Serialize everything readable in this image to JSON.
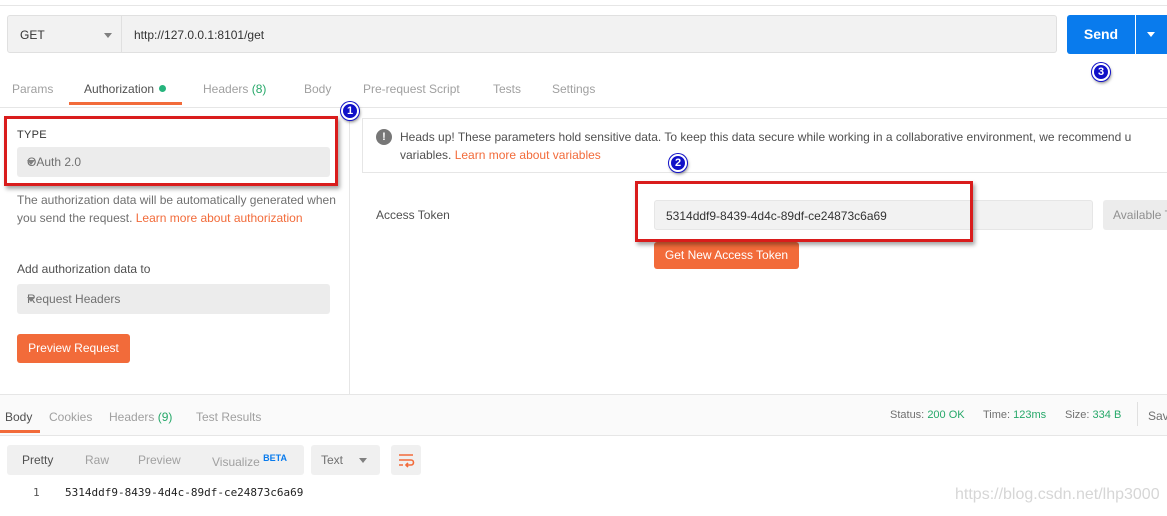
{
  "request": {
    "method": "GET",
    "url": "http://127.0.0.1:8101/get",
    "send_label": "Send"
  },
  "request_tabs": [
    {
      "label": "Params"
    },
    {
      "label": "Authorization"
    },
    {
      "label": "Headers",
      "count": "(8)"
    },
    {
      "label": "Body"
    },
    {
      "label": "Pre-request Script"
    },
    {
      "label": "Tests"
    },
    {
      "label": "Settings"
    }
  ],
  "auth": {
    "type_label": "TYPE",
    "type_value": "OAuth 2.0",
    "description": "The authorization data will be automatically generated when you send the request. ",
    "learn_more": "Learn more about authorization",
    "add_to_label": "Add authorization data to",
    "add_to_value": "Request Headers",
    "preview_button": "Preview Request"
  },
  "notice": {
    "text": "Heads up! These parameters hold sensitive data. To keep this data secure while working in a collaborative environment, we recommend u",
    "text_line2": "variables. ",
    "link": "Learn more about variables"
  },
  "token": {
    "label": "Access Token",
    "value": "5314ddf9-8439-4d4c-89df-ce24873c6a69",
    "available_label": "Available T",
    "get_new_button": "Get New Access Token"
  },
  "annotations": [
    "1",
    "2",
    "3"
  ],
  "response_tabs": [
    {
      "label": "Body"
    },
    {
      "label": "Cookies"
    },
    {
      "label": "Headers",
      "count": "(9)"
    },
    {
      "label": "Test Results"
    }
  ],
  "response_status": {
    "status_label": "Status:",
    "status_value": "200 OK",
    "time_label": "Time:",
    "time_value": "123ms",
    "size_label": "Size:",
    "size_value": "334 B",
    "save_label": "Sav"
  },
  "format_tabs": {
    "pretty": "Pretty",
    "raw": "Raw",
    "preview": "Preview",
    "visualize": "Visualize",
    "beta": "BETA"
  },
  "format_select": "Text",
  "body": {
    "line_number": "1",
    "content": "5314ddf9-8439-4d4c-89df-ce24873c6a69"
  },
  "watermark": "https://blog.csdn.net/lhp3000",
  "colors": {
    "accent_orange": "#f26b3a",
    "send_blue": "#097bed",
    "success_green": "#26a869",
    "annotation_red": "#d91c1c"
  }
}
